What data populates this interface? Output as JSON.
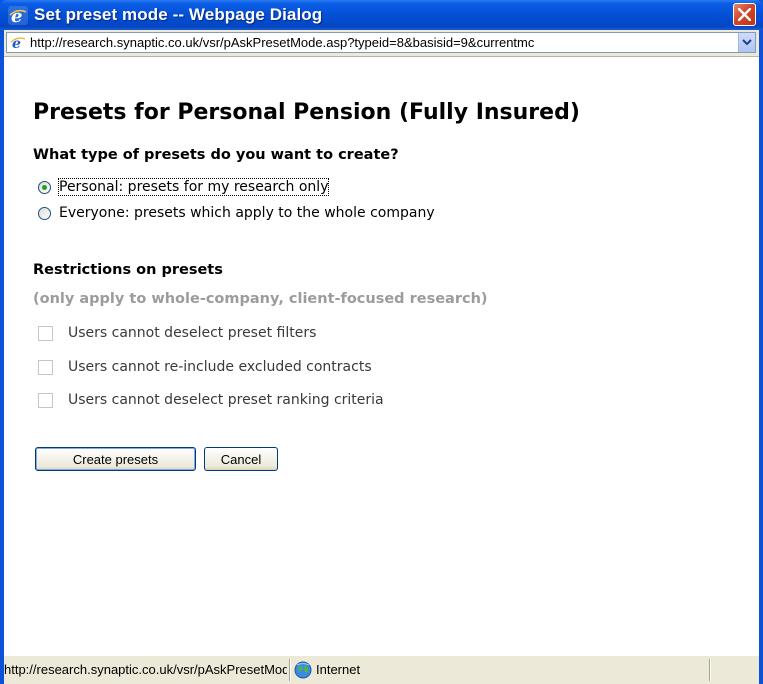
{
  "window": {
    "title": "Set preset mode -- Webpage Dialog",
    "close_icon": "close-icon",
    "app_icon": "ie-icon"
  },
  "address": {
    "url": "http://research.synaptic.co.uk/vsr/pAskPresetMode.asp?typeid=8&basisid=9&currentmc",
    "dropdown_icon": "chevron-down-icon"
  },
  "content": {
    "heading": "Presets for Personal Pension (Fully Insured)",
    "question": "What type of presets do you want to create?",
    "options": [
      {
        "label": "Personal: presets for my research only",
        "checked": true
      },
      {
        "label": "Everyone: presets which apply to the whole company",
        "checked": false
      }
    ],
    "restrictions_title": "Restrictions on presets",
    "restrictions_note": "(only apply to whole-company, client-focused research)",
    "restrictions": [
      {
        "label": "Users cannot deselect preset filters",
        "checked": false
      },
      {
        "label": "Users cannot re-include excluded contracts",
        "checked": false
      },
      {
        "label": "Users cannot deselect preset ranking criteria",
        "checked": false
      }
    ],
    "buttons": {
      "create": "Create presets",
      "cancel": "Cancel"
    }
  },
  "status": {
    "url": "http://research.synaptic.co.uk/vsr/pAskPresetMode.asp?",
    "zone": "Internet",
    "zone_icon": "globe-icon"
  },
  "colors": {
    "titlebar": "#0350d6",
    "radio_dot": "#21a121",
    "disabled_text": "#9c9c9c"
  }
}
